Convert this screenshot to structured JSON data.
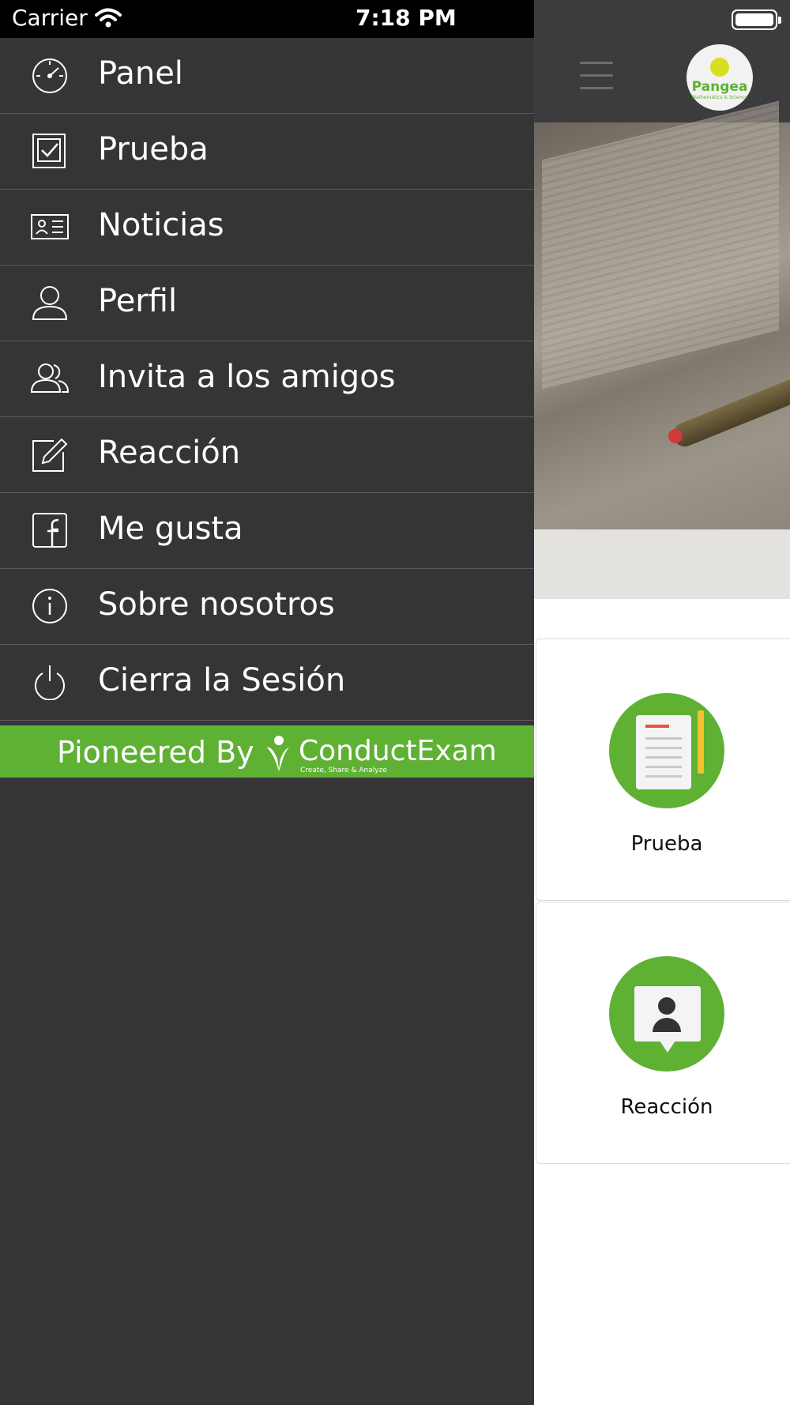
{
  "status_bar": {
    "carrier": "Carrier",
    "time": "7:18 PM"
  },
  "app": {
    "logo_text": "Pangea",
    "logo_subtext": "Mathematics & Science",
    "cards": [
      {
        "label": "Prueba",
        "icon": "test-paper-icon"
      },
      {
        "label": "Reacción",
        "icon": "feedback-bubble-icon"
      }
    ]
  },
  "drawer": {
    "items": [
      {
        "label": "Panel",
        "icon": "dashboard-icon"
      },
      {
        "label": "Prueba",
        "icon": "test-icon"
      },
      {
        "label": "Noticias",
        "icon": "news-icon"
      },
      {
        "label": "Perfil",
        "icon": "profile-icon"
      },
      {
        "label": "Invita a los amigos",
        "icon": "invite-friends-icon"
      },
      {
        "label": "Reacción",
        "icon": "feedback-icon"
      },
      {
        "label": "Me gusta",
        "icon": "facebook-icon"
      },
      {
        "label": "Sobre nosotros",
        "icon": "info-icon"
      },
      {
        "label": "Cierra la Sesión",
        "icon": "logout-icon"
      }
    ],
    "footer": {
      "prefix": "Pioneered By",
      "brand": "ConductExam",
      "tagline": "Create, Share & Analyze"
    }
  },
  "colors": {
    "drawer_bg": "#353436",
    "accent_green": "#5fb134",
    "header_bg": "#3c3b3d"
  }
}
